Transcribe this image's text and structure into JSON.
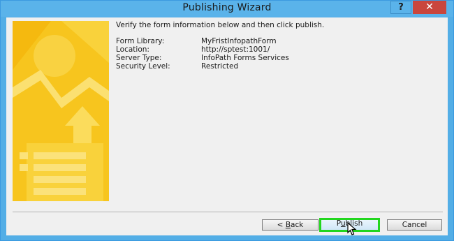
{
  "window": {
    "title": "Publishing Wizard",
    "help_label": "?",
    "close_label": "✕"
  },
  "intro_text": "Verify the form information below and then click publish.",
  "info": [
    {
      "label": "Form Library:",
      "value": "MyFristInfopathForm"
    },
    {
      "label": "Location:",
      "value": "http://sptest:1001/"
    },
    {
      "label": "Server Type:",
      "value": "InfoPath Forms Services"
    },
    {
      "label": "Security Level:",
      "value": "Restricted"
    }
  ],
  "buttons": {
    "back": {
      "prefix": "< ",
      "mnemonic": "B",
      "rest": "ack"
    },
    "publish": {
      "prefix": "P",
      "mnemonic": "u",
      "rest": "blish"
    },
    "cancel": {
      "label": "Cancel"
    }
  },
  "colors": {
    "title_bar": "#5ab3ea",
    "close_button": "#c9463d",
    "highlight_border": "#22d61e",
    "banner_yellow": "#f7c51e"
  }
}
